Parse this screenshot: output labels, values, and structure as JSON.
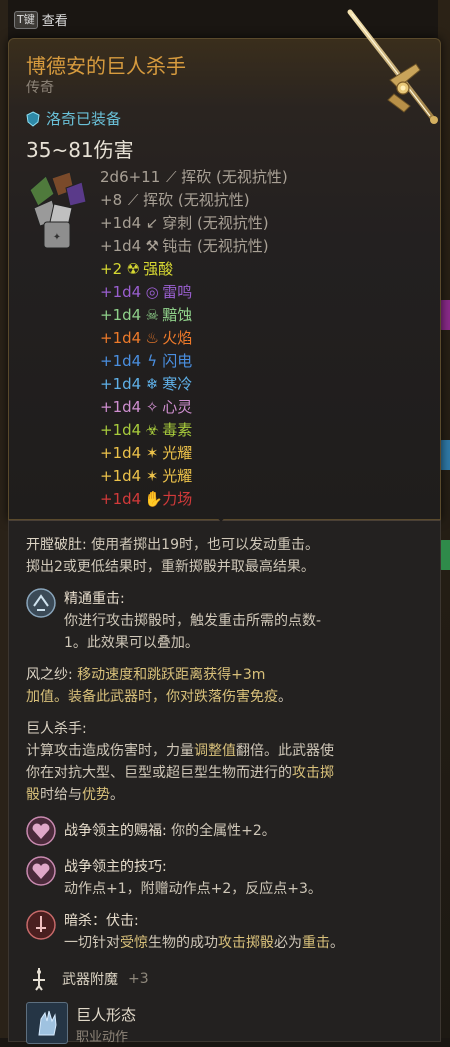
{
  "hint": {
    "key": "T键",
    "label": "查看"
  },
  "item": {
    "name": "博德安的巨人杀手",
    "rarity": "传奇",
    "equipped_text": "洛奇已装备",
    "damage": "35~81伤害"
  },
  "damage_rows": [
    {
      "amount": "2d6+11",
      "icon": "slash-icon",
      "glyph": "⟋",
      "type": "挥砍 (无视抗性)",
      "color": "#a8a095"
    },
    {
      "amount": "+8",
      "icon": "slash-icon",
      "glyph": "⟋",
      "type": "挥砍 (无视抗性)",
      "color": "#a8a095"
    },
    {
      "amount": "+1d4",
      "icon": "pierce-icon",
      "glyph": "↙",
      "type": "穿刺 (无视抗性)",
      "color": "#a8a095"
    },
    {
      "amount": "+1d4",
      "icon": "bludgeon-icon",
      "glyph": "⚒",
      "type": "钝击 (无视抗性)",
      "color": "#a8a095"
    },
    {
      "amount": "+2",
      "icon": "acid-icon",
      "glyph": "☢",
      "type": "强酸",
      "color": "#d6d832"
    },
    {
      "amount": "+1d4",
      "icon": "thunder-icon",
      "glyph": "◎",
      "type": "雷鸣",
      "color": "#9a5fd0"
    },
    {
      "amount": "+1d4",
      "icon": "necrotic-icon",
      "glyph": "☠",
      "type": "黯蚀",
      "color": "#8fd08a"
    },
    {
      "amount": "+1d4",
      "icon": "fire-icon",
      "glyph": "♨",
      "type": "火焰",
      "color": "#ee7a2a"
    },
    {
      "amount": "+1d4",
      "icon": "lightning-icon",
      "glyph": "ϟ",
      "type": "闪电",
      "color": "#4a8fe0"
    },
    {
      "amount": "+1d4",
      "icon": "cold-icon",
      "glyph": "❄",
      "type": "寒冷",
      "color": "#5fb0e8"
    },
    {
      "amount": "+1d4",
      "icon": "psychic-icon",
      "glyph": "✧",
      "type": "心灵",
      "color": "#cf8fd0"
    },
    {
      "amount": "+1d4",
      "icon": "poison-icon",
      "glyph": "☣",
      "type": "毒素",
      "color": "#a8cc3c"
    },
    {
      "amount": "+1d4",
      "icon": "radiant-icon",
      "glyph": "✶",
      "type": "光耀",
      "color": "#ecc24a"
    },
    {
      "amount": "+1d4",
      "icon": "radiant-icon",
      "glyph": "✶",
      "type": "光耀",
      "color": "#ecc24a"
    },
    {
      "amount": "+1d4",
      "icon": "force-icon",
      "glyph": "✋",
      "type": "力场",
      "color": "#d23a3a"
    }
  ],
  "properties": {
    "p1_title": "开膛破肚:",
    "p1_line1": "使用者掷出19时，也可以发动重击。",
    "p1_line2": "掷出2或更低结果时，重新掷骰并取最高结果。",
    "p2_title": "精通重击:",
    "p2_line1": "你进行攻击掷骰时，触发重击所需的点数-",
    "p2_line2": "1。此效果可以叠加。",
    "p3_title": "风之纱:",
    "p3_line1": "移动速度和跳跃距离获得+3m",
    "p3_line2a": "加值。装备此武器时，你对",
    "p3_line2b": "跌落伤害免疫",
    "p3_line2c": "。",
    "p4_title": "巨人杀手:",
    "p4_line1a": "计算攻击造成伤害时，力量",
    "p4_line1b": "调整值",
    "p4_line1c": "翻倍。此武器使",
    "p4_line2a": "你在对抗大型、巨型或超巨型生物而进行的",
    "p4_line2b": "攻击掷",
    "p4_line3a": "骰",
    "p4_line3b": "时给与",
    "p4_line3c": "优势",
    "p4_line3d": "。",
    "p5_title": "战争领主的赐福:",
    "p5_text": "你的全属性+2。",
    "p6_title": "战争领主的技巧:",
    "p6_line": "动作点+1，附赠动作点+2，反应点+3。",
    "p7_title": "暗杀：伏击:",
    "p7_line_a": "一切针对",
    "p7_line_b": "受惊",
    "p7_line_c": "生物的成功",
    "p7_line_d": "攻击掷骰",
    "p7_line_e": "必为",
    "p7_line_f": "重击",
    "p7_line_g": "。"
  },
  "enchant": {
    "label": "武器附魔",
    "value": "+3"
  },
  "action": {
    "name": "巨人形态",
    "sub": "职业动作"
  },
  "colors": {
    "title": "#d79b3e",
    "equipped": "#6ac1d8",
    "highlight": "#d8c07a"
  }
}
